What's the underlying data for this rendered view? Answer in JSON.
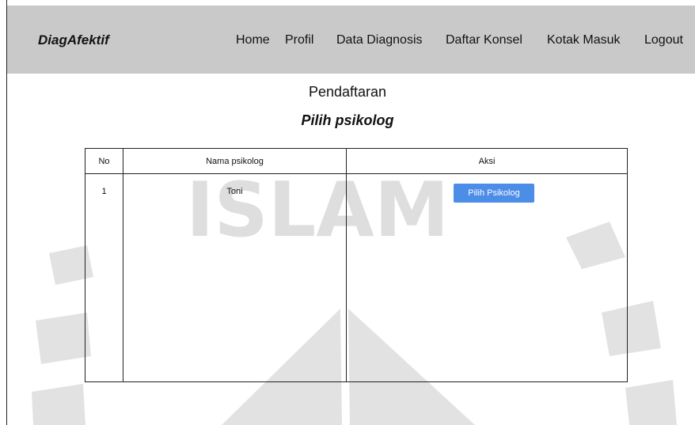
{
  "navbar": {
    "brand": "DiagAfektif",
    "items": [
      {
        "label": "Home"
      },
      {
        "label": "Profil"
      },
      {
        "label": "Data Diagnosis"
      },
      {
        "label": "Daftar Konsel"
      },
      {
        "label": "Kotak Masuk"
      },
      {
        "label": "Logout"
      }
    ],
    "background_color": "#c9c9c9"
  },
  "page": {
    "title": "Pendaftaran",
    "subtitle": "Pilih psikolog"
  },
  "table": {
    "columns": [
      "No",
      "Nama psikolog",
      "Aksi"
    ],
    "rows": [
      {
        "no": "1",
        "name": "Toni",
        "action_label": "Pilih Psikolog"
      }
    ]
  },
  "watermark": {
    "text": "ISLAM"
  },
  "colors": {
    "button": "#4c8de8",
    "button_text": "#ffffff"
  },
  "icons": {
    "watermark": "university-seal-watermark"
  }
}
